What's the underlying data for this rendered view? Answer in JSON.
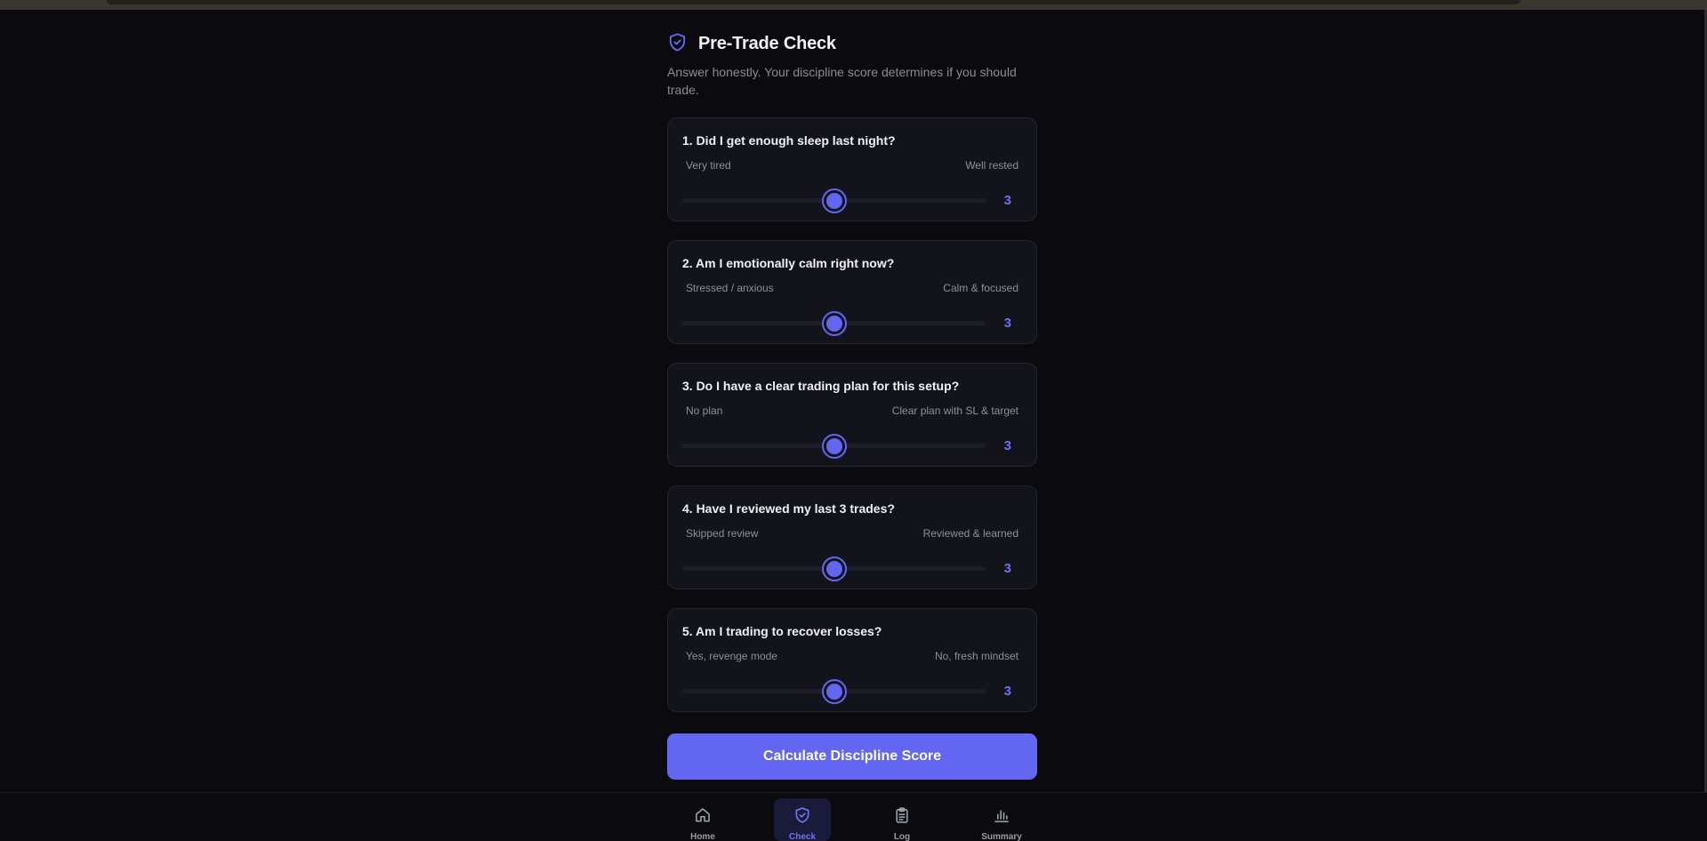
{
  "colors": {
    "accent": "#6366f1",
    "background": "#0b0b0f",
    "card": "#13131b"
  },
  "header": {
    "icon": "shield-check-icon",
    "title": "Pre-Trade Check",
    "subtitle": "Answer honestly. Your discipline score determines if you should trade."
  },
  "questions": [
    {
      "question": "1. Did I get enough sleep last night?",
      "low_label": "Very tired",
      "high_label": "Well rested",
      "value": "3",
      "min": 1,
      "max": 5
    },
    {
      "question": "2. Am I emotionally calm right now?",
      "low_label": "Stressed / anxious",
      "high_label": "Calm & focused",
      "value": "3",
      "min": 1,
      "max": 5
    },
    {
      "question": "3. Do I have a clear trading plan for this setup?",
      "low_label": "No plan",
      "high_label": "Clear plan with SL & target",
      "value": "3",
      "min": 1,
      "max": 5
    },
    {
      "question": "4. Have I reviewed my last 3 trades?",
      "low_label": "Skipped review",
      "high_label": "Reviewed & learned",
      "value": "3",
      "min": 1,
      "max": 5
    },
    {
      "question": "5. Am I trading to recover losses?",
      "low_label": "Yes, revenge mode",
      "high_label": "No, fresh mindset",
      "value": "3",
      "min": 1,
      "max": 5
    }
  ],
  "calculate_button": {
    "label": "Calculate Discipline Score"
  },
  "bottom_nav": [
    {
      "label": "Home",
      "icon": "home-icon",
      "active": false
    },
    {
      "label": "Check",
      "icon": "shield-check-icon",
      "active": true
    },
    {
      "label": "Log",
      "icon": "clipboard-icon",
      "active": false
    },
    {
      "label": "Summary",
      "icon": "bar-chart-icon",
      "active": false
    }
  ]
}
